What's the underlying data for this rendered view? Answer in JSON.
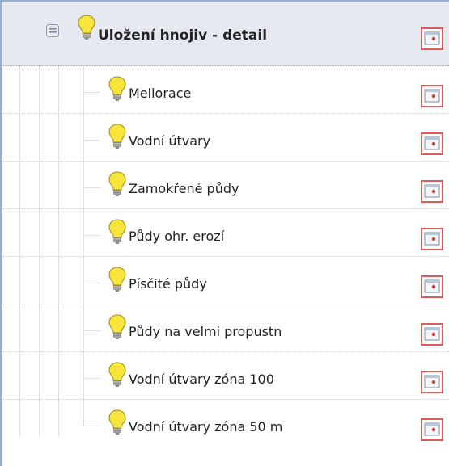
{
  "tree": {
    "parent": {
      "label": "Uložení hnojiv - detail",
      "expanded": true,
      "icon": "lightbulb-icon",
      "action_icon": "map-layer-icon"
    },
    "children": [
      {
        "label": "Meliorace",
        "icon": "lightbulb-icon",
        "action_icon": "map-layer-icon"
      },
      {
        "label": "Vodní útvary",
        "icon": "lightbulb-icon",
        "action_icon": "map-layer-icon"
      },
      {
        "label": "Zamokřené půdy",
        "icon": "lightbulb-icon",
        "action_icon": "map-layer-icon"
      },
      {
        "label": "Půdy ohr. erozí",
        "icon": "lightbulb-icon",
        "action_icon": "map-layer-icon"
      },
      {
        "label": "Písčité půdy",
        "icon": "lightbulb-icon",
        "action_icon": "map-layer-icon"
      },
      {
        "label": "Půdy na velmi propustn",
        "icon": "lightbulb-icon",
        "action_icon": "map-layer-icon"
      },
      {
        "label": "Vodní útvary zóna 100",
        "icon": "lightbulb-icon",
        "action_icon": "map-layer-icon"
      },
      {
        "label": "Vodní útvary zóna 50 m",
        "icon": "lightbulb-icon",
        "action_icon": "map-layer-icon"
      }
    ]
  },
  "colors": {
    "frame": "#8fb0d8",
    "parent_row_bg": "#e6eaf0",
    "bulb": "#f7e53b",
    "action_border": "#e05a5a"
  }
}
